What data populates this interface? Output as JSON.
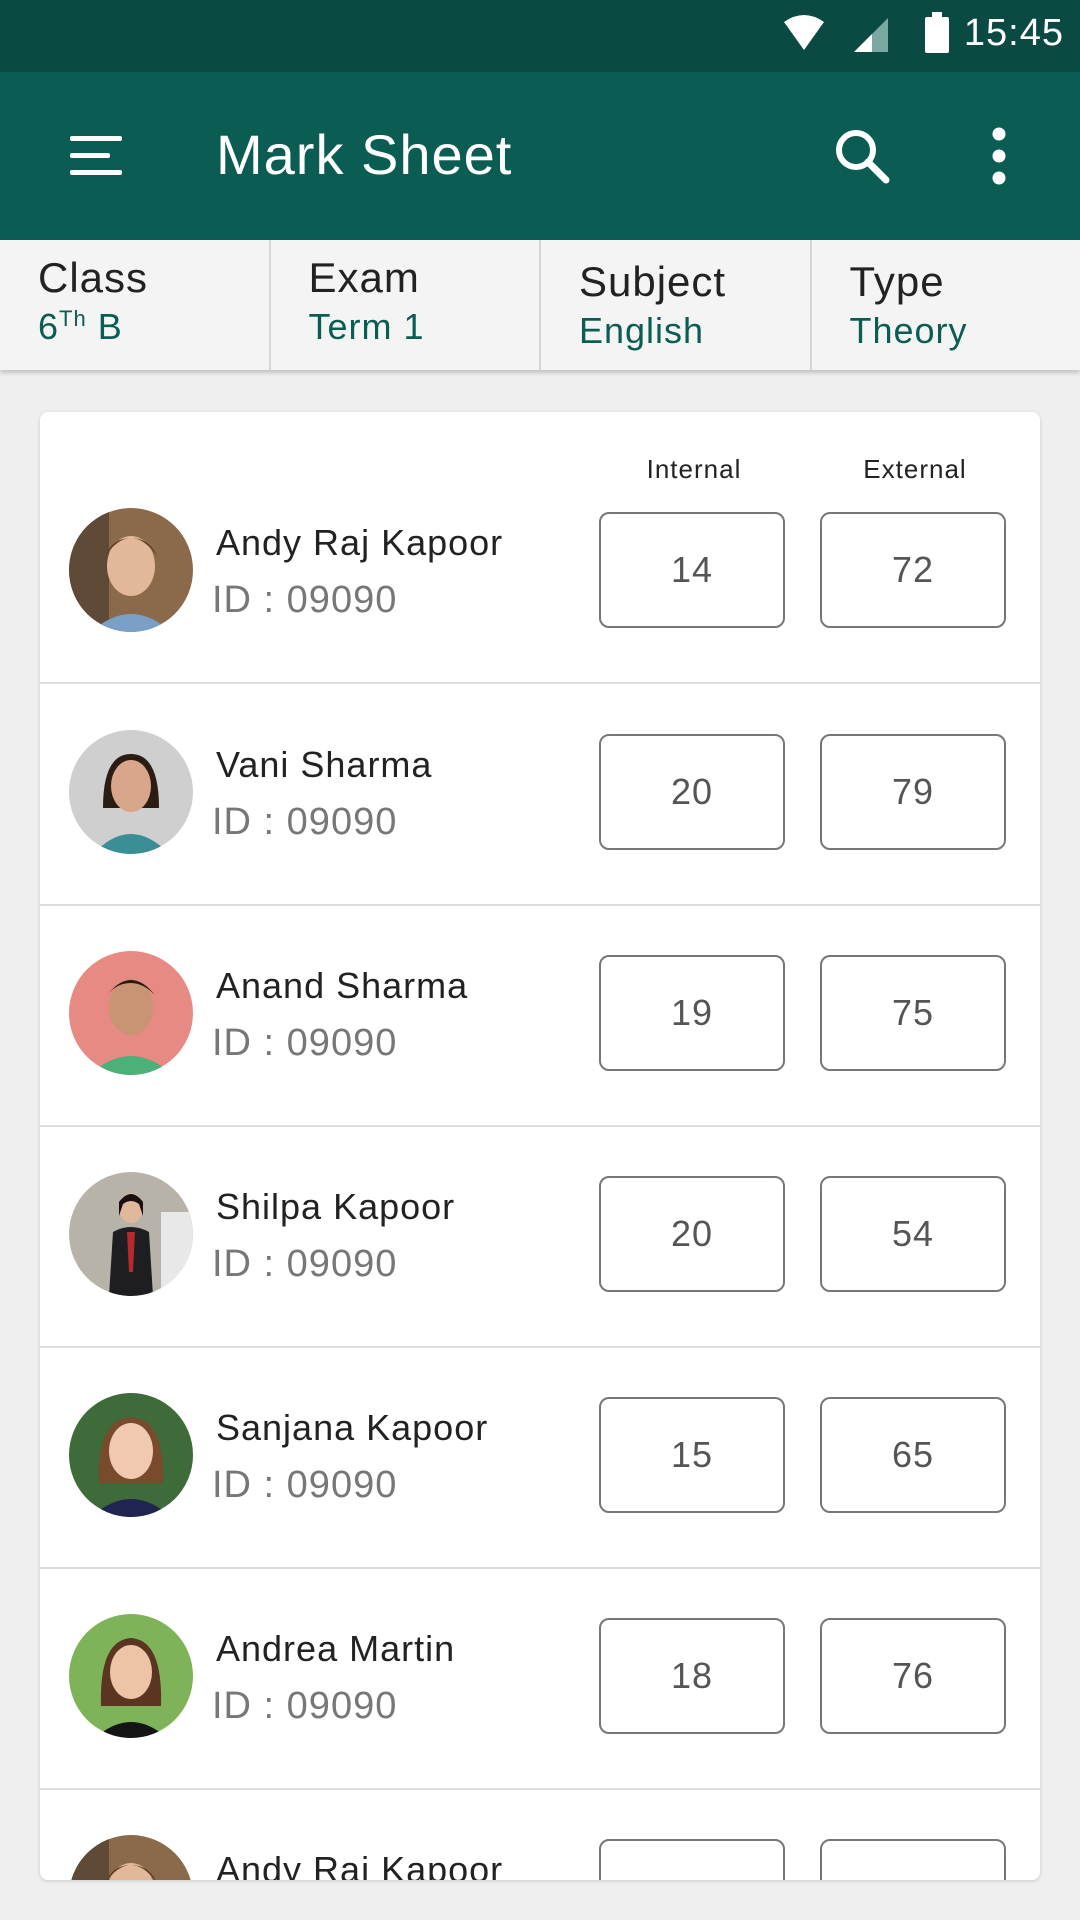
{
  "status_bar": {
    "time": "15:45",
    "icons": [
      "wifi-icon",
      "signal-icon",
      "battery-icon"
    ]
  },
  "app_bar": {
    "title": "Mark Sheet",
    "icons": [
      "menu-icon",
      "search-icon",
      "more-vert-icon"
    ]
  },
  "filters": {
    "class": {
      "label": "Class",
      "value_grade": "6",
      "value_suffix": "Th",
      "value_section": " B"
    },
    "exam": {
      "label": "Exam",
      "value": "Term 1"
    },
    "subject": {
      "label": "Subject",
      "value": "English"
    },
    "type": {
      "label": "Type",
      "value": "Theory"
    }
  },
  "columns": {
    "internal": "Internal",
    "external": "External"
  },
  "students": [
    {
      "name": "Andy Raj Kapoor",
      "id": "ID : 09090",
      "internal": "14",
      "external": "72"
    },
    {
      "name": "Vani Sharma",
      "id": "ID : 09090",
      "internal": "20",
      "external": "79"
    },
    {
      "name": "Anand Sharma",
      "id": "ID : 09090",
      "internal": "19",
      "external": "75"
    },
    {
      "name": "Shilpa Kapoor",
      "id": "ID : 09090",
      "internal": "20",
      "external": "54"
    },
    {
      "name": "Sanjana Kapoor",
      "id": "ID : 09090",
      "internal": "15",
      "external": "65"
    },
    {
      "name": "Andrea Martin",
      "id": "ID : 09090",
      "internal": "18",
      "external": "76"
    },
    {
      "name": "Andy Raj Kapoor",
      "id": "",
      "internal": "",
      "external": ""
    }
  ],
  "colors": {
    "primary_dark": "#0a4a43",
    "primary": "#0b5c53",
    "accent_text": "#0b5c53"
  }
}
